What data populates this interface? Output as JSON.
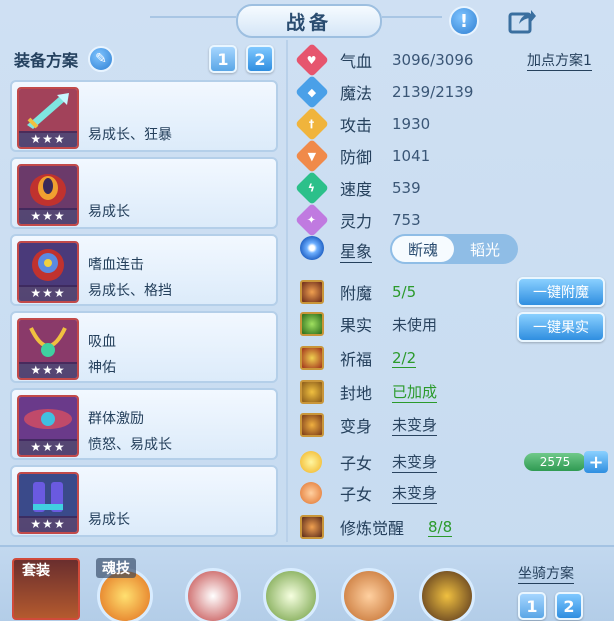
{
  "header": {
    "title": "战备"
  },
  "left": {
    "title": "装备方案",
    "plan_buttons": [
      "1",
      "2"
    ],
    "items": [
      {
        "line1": "",
        "line2": "易成长、狂暴",
        "stars": "★★★"
      },
      {
        "line1": "",
        "line2": "易成长",
        "stars": "★★★"
      },
      {
        "line1": "嗜血连击",
        "line2": "易成长、格挡",
        "stars": "★★★"
      },
      {
        "line1": "吸血",
        "line2": "神佑",
        "stars": "★★★"
      },
      {
        "line1": "群体激励",
        "line2": "愤怒、易成长",
        "stars": "★★★"
      },
      {
        "line1": "",
        "line2": "易成长",
        "stars": "★★★"
      }
    ]
  },
  "stats": {
    "plan_link": "加点方案1",
    "rows": [
      {
        "label": "气血",
        "value": "3096/3096",
        "color": "#e6556e"
      },
      {
        "label": "魔法",
        "value": "2139/2139",
        "color": "#4aa0e8"
      },
      {
        "label": "攻击",
        "value": "1930",
        "color": "#f0b43c"
      },
      {
        "label": "防御",
        "value": "1041",
        "color": "#f08a4a"
      },
      {
        "label": "速度",
        "value": "539",
        "color": "#2cc08a"
      },
      {
        "label": "灵力",
        "value": "753",
        "color": "#c07ae0"
      }
    ],
    "star": {
      "label": "星象",
      "options": [
        "断魂",
        "韬光"
      ],
      "selected": "断魂"
    }
  },
  "extras": [
    {
      "label": "附魔",
      "value": "5/5",
      "style": "green"
    },
    {
      "label": "果实",
      "value": "未使用",
      "style": "dark"
    },
    {
      "label": "祈福",
      "value": "2/2",
      "style": "green-ul"
    },
    {
      "label": "封地",
      "value": "已加成",
      "style": "green-ul"
    },
    {
      "label": "变身",
      "value": "未变身",
      "style": "dark-ul"
    },
    {
      "label": "子女",
      "value": "未变身",
      "style": "dark-ul"
    },
    {
      "label": "子女",
      "value": "未变身",
      "style": "dark-ul"
    },
    {
      "label": "修炼觉醒",
      "value": "8/8",
      "style": "green-ul"
    }
  ],
  "actions": {
    "enchant": "一键附魔",
    "fruit": "一键果实"
  },
  "counter": {
    "value": "2575",
    "plus": "+"
  },
  "bottom": {
    "suit_label": "套装",
    "skill_label": "魂技",
    "mount_title": "坐骑方案",
    "mount_buttons": [
      "1",
      "2"
    ]
  }
}
